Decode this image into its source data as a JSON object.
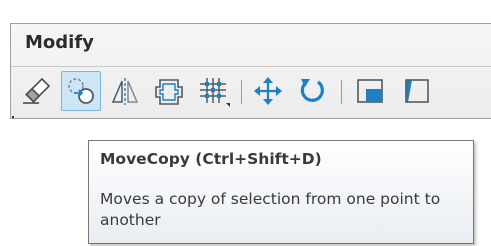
{
  "panel": {
    "title": "Modify"
  },
  "toolbar": {
    "tools": [
      {
        "icon": "eraser-icon",
        "active": false
      },
      {
        "icon": "move-copy-icon",
        "active": true
      },
      {
        "icon": "mirror-icon",
        "active": false
      },
      {
        "icon": "offset-icon",
        "active": false
      },
      {
        "icon": "grid-array-icon",
        "active": false,
        "has_dropdown": true
      },
      {
        "icon": "move-icon",
        "active": false
      },
      {
        "icon": "rotate-icon",
        "active": false
      },
      {
        "icon": "scale-icon",
        "active": false
      },
      {
        "icon": "stretch-icon",
        "active": false
      }
    ]
  },
  "tooltip": {
    "title": "MoveCopy (Ctrl+Shift+D)",
    "description": "Moves a copy of selection from one point to another"
  },
  "colors": {
    "icon_blue": "#1f7fc4",
    "icon_gray": "#505a64",
    "active_bg": "#cde6f7",
    "active_border": "#79b6e0"
  }
}
